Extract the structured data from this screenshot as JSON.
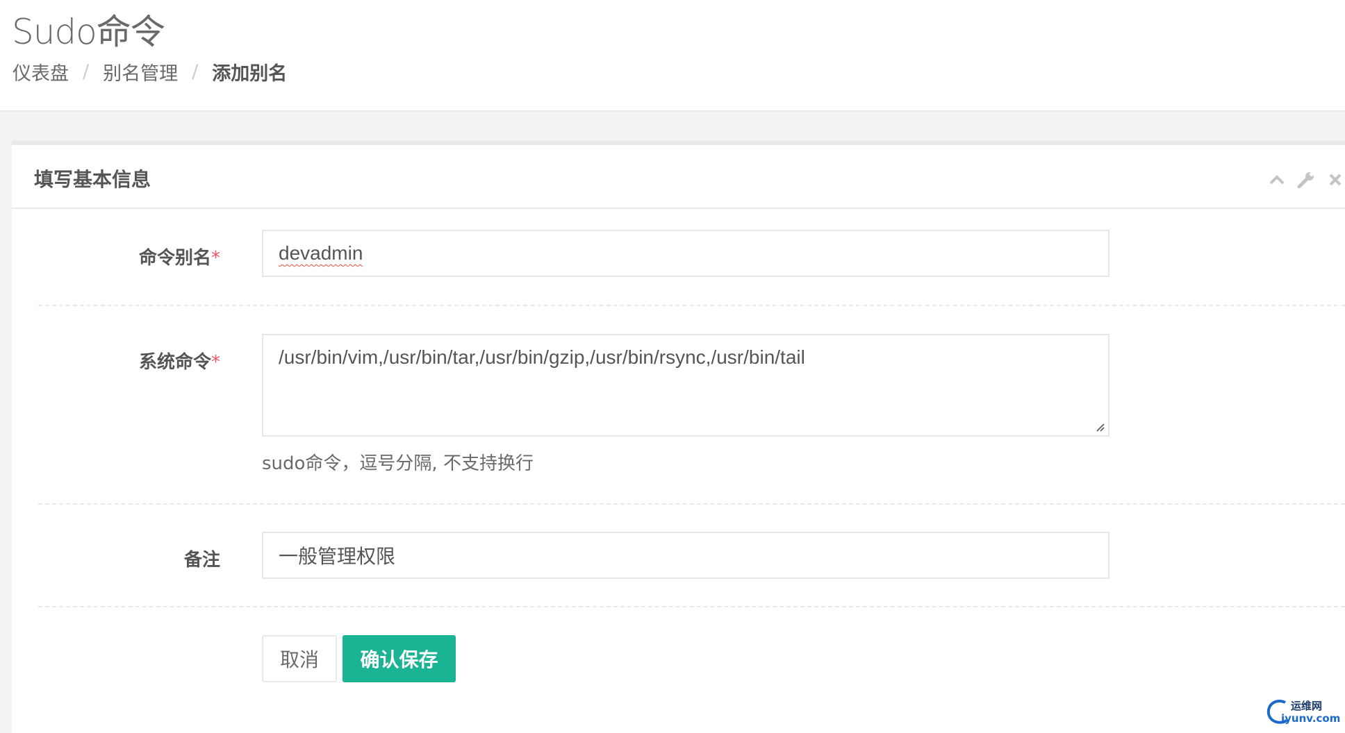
{
  "page": {
    "title": "Sudo命令",
    "breadcrumb": [
      "仪表盘",
      "别名管理",
      "添加别名"
    ],
    "breadcrumb_separator": "/"
  },
  "panel": {
    "title": "填写基本信息",
    "tools": [
      "chevron-up-icon",
      "wrench-icon",
      "close-icon"
    ]
  },
  "form": {
    "alias_label": "命令别名",
    "alias_value": "devadmin",
    "command_label": "系统命令",
    "command_value": "/usr/bin/vim,/usr/bin/tar,/usr/bin/gzip,/usr/bin/rsync,/usr/bin/tail",
    "command_help": "sudo命令，逗号分隔, 不支持换行",
    "note_label": "备注",
    "note_value": "一般管理权限",
    "required_mark": "*"
  },
  "buttons": {
    "cancel": "取消",
    "save": "确认保存"
  },
  "watermark": {
    "line1": "运维网",
    "line2": "iyunv.com"
  },
  "colors": {
    "primary": "#1ab394",
    "required": "#ed5565",
    "border": "#e7eaec"
  }
}
